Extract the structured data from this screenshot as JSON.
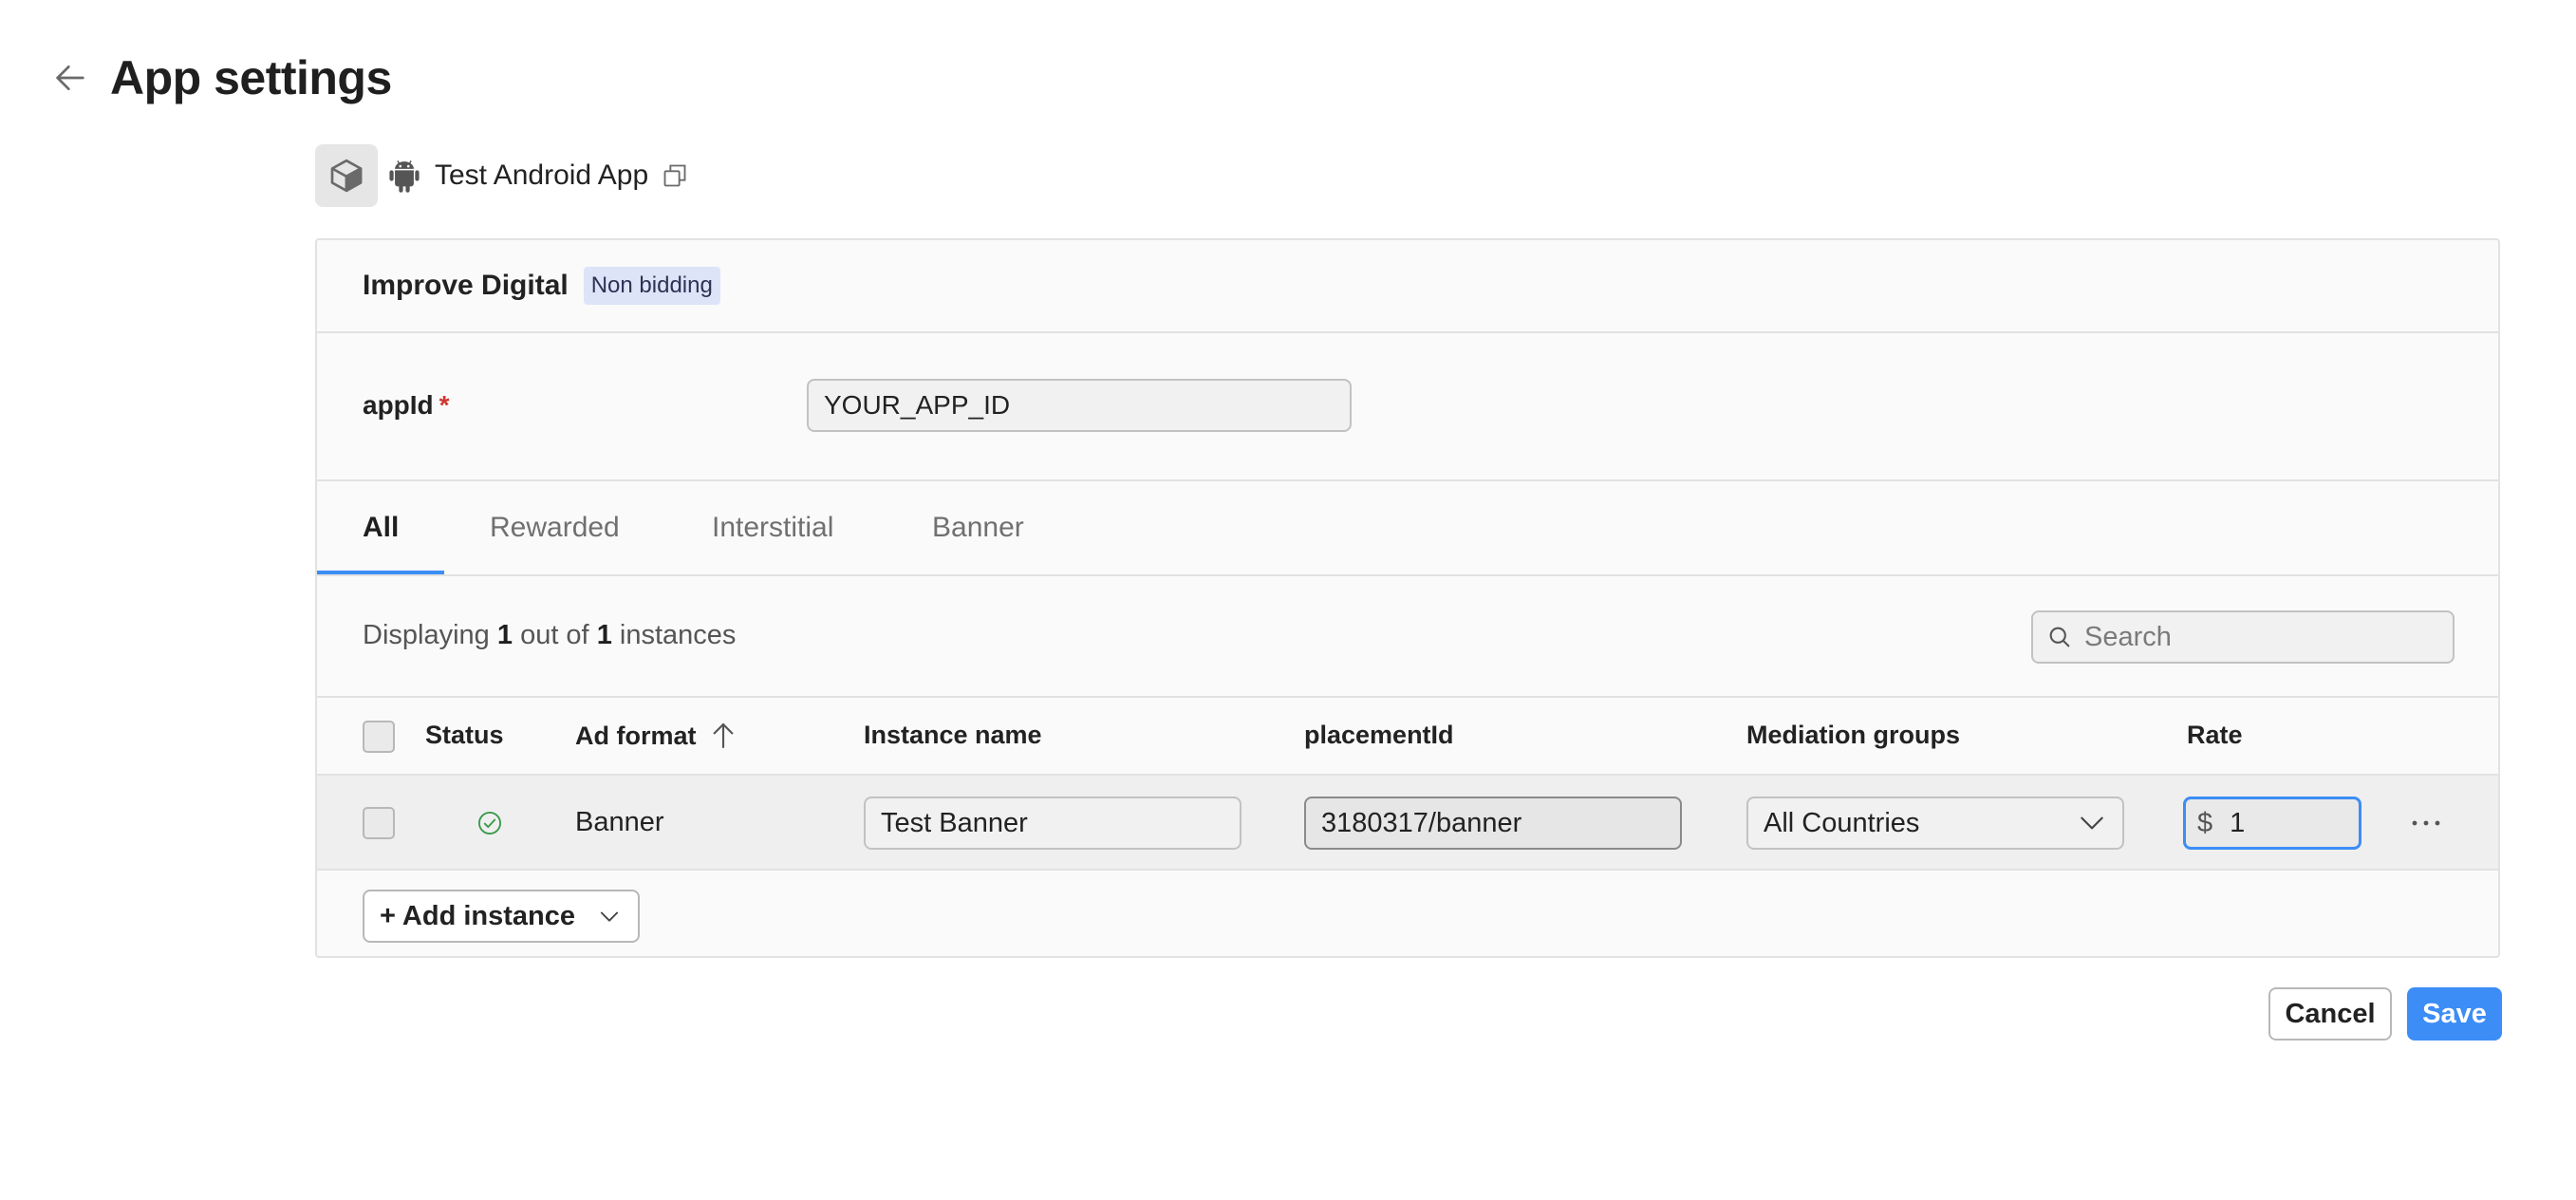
{
  "header": {
    "title": "App settings",
    "back_icon": "arrow-left-icon"
  },
  "app": {
    "name": "Test Android App",
    "logo_icon": "cube-icon",
    "platform_icon": "android-icon",
    "copy_icon": "copy-icon"
  },
  "network": {
    "name": "Improve Digital",
    "badge": "Non bidding"
  },
  "app_id": {
    "label": "appId",
    "required_mark": "*",
    "value": "YOUR_APP_ID"
  },
  "tabs": [
    {
      "label": "All",
      "active": true
    },
    {
      "label": "Rewarded",
      "active": false
    },
    {
      "label": "Interstitial",
      "active": false
    },
    {
      "label": "Banner",
      "active": false
    }
  ],
  "summary": {
    "prefix": "Displaying",
    "shown": "1",
    "middle": "out of",
    "total": "1",
    "suffix": "instances"
  },
  "search": {
    "placeholder": "Search"
  },
  "table": {
    "columns": {
      "status": "Status",
      "ad_format": "Ad format",
      "instance_name": "Instance name",
      "placement_id": "placementId",
      "mediation_groups": "Mediation groups",
      "rate": "Rate"
    },
    "rows": [
      {
        "status": "active",
        "ad_format": "Banner",
        "instance_name": "Test Banner",
        "placement_id": "3180317/banner",
        "mediation_group": "All Countries",
        "rate_currency": "$",
        "rate": "1"
      }
    ]
  },
  "add_instance": {
    "label": "+ Add instance"
  },
  "actions": {
    "cancel": "Cancel",
    "save": "Save"
  },
  "colors": {
    "accent": "#3c8df5",
    "badge_bg": "#dde4f8",
    "required": "#d0362f",
    "status_ok": "#3a9a4a"
  }
}
